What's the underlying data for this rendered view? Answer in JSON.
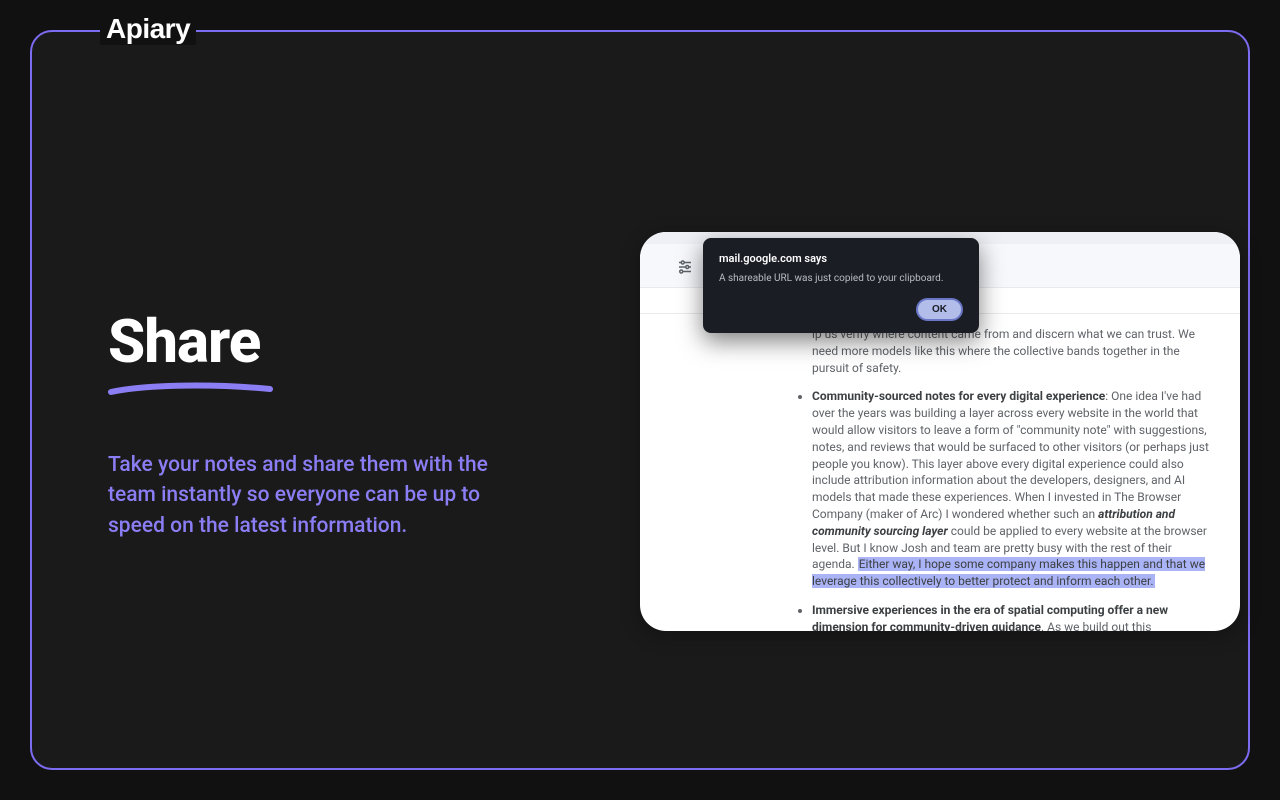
{
  "brand": "Apiary",
  "heading": "Share",
  "description": "Take your notes and share them with the team instantly so everyone can be up to speed on the latest information.",
  "dialog": {
    "title": "mail.google.com says",
    "body": "A shareable URL was just copied to your clipboard.",
    "ok": "OK"
  },
  "email": {
    "frag0_trail": "lp us verify where content came from and discern what we can trust. We need more models like this where the collective bands together in the pursuit of safety.",
    "frag1_bold": "Community-sourced notes for every digital experience",
    "frag1_after": ": One idea I've had over the years was building a layer across every website in the world that would allow visitors to leave a form of \"community note\" with suggestions, notes, and reviews that would be surfaced to other visitors (or perhaps just people you know). This layer above every digital experience could also include attribution information about the developers, designers, and AI models that made these experiences. When I invested in The Browser Company (maker of Arc) I wondered whether such an ",
    "frag1_italic": "attribution and community sourcing layer",
    "frag1_after2": " could be applied to every website at the browser level. But I know Josh and team are pretty busy with the rest of their agenda. ",
    "frag1_highlight": "Either way, I hope some company makes this happen and that we leverage this collectively to better protect and inform each other.",
    "frag2_bold": "Immersive experiences in the era of spatial computing offer a new dimension for community-driven guidance",
    "frag2_after": ". As we build out this"
  }
}
